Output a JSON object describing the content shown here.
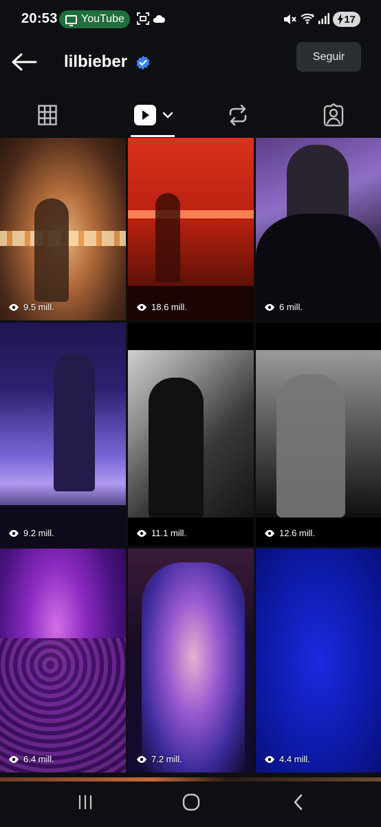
{
  "status_bar": {
    "time": "20:53",
    "pill_label": "YouTube",
    "battery": "17"
  },
  "header": {
    "username": "lilbieber",
    "follow_label": "Seguir"
  },
  "tabs": [
    {
      "name": "grid"
    },
    {
      "name": "reels",
      "active": true
    },
    {
      "name": "reposts"
    },
    {
      "name": "tagged"
    }
  ],
  "reels": [
    {
      "views": "9.5 mill."
    },
    {
      "views": "18.6 mill."
    },
    {
      "views": "6 mill."
    },
    {
      "views": "9.2 mill."
    },
    {
      "views": "11.1 mill."
    },
    {
      "views": "12.6 mill."
    },
    {
      "views": "6.4 mill."
    },
    {
      "views": "7.2 mill."
    },
    {
      "views": "4.4 mill."
    }
  ],
  "colors": {
    "background": "#0d0f12",
    "verified": "#3b82f6",
    "pill": "#1f6e3d"
  }
}
